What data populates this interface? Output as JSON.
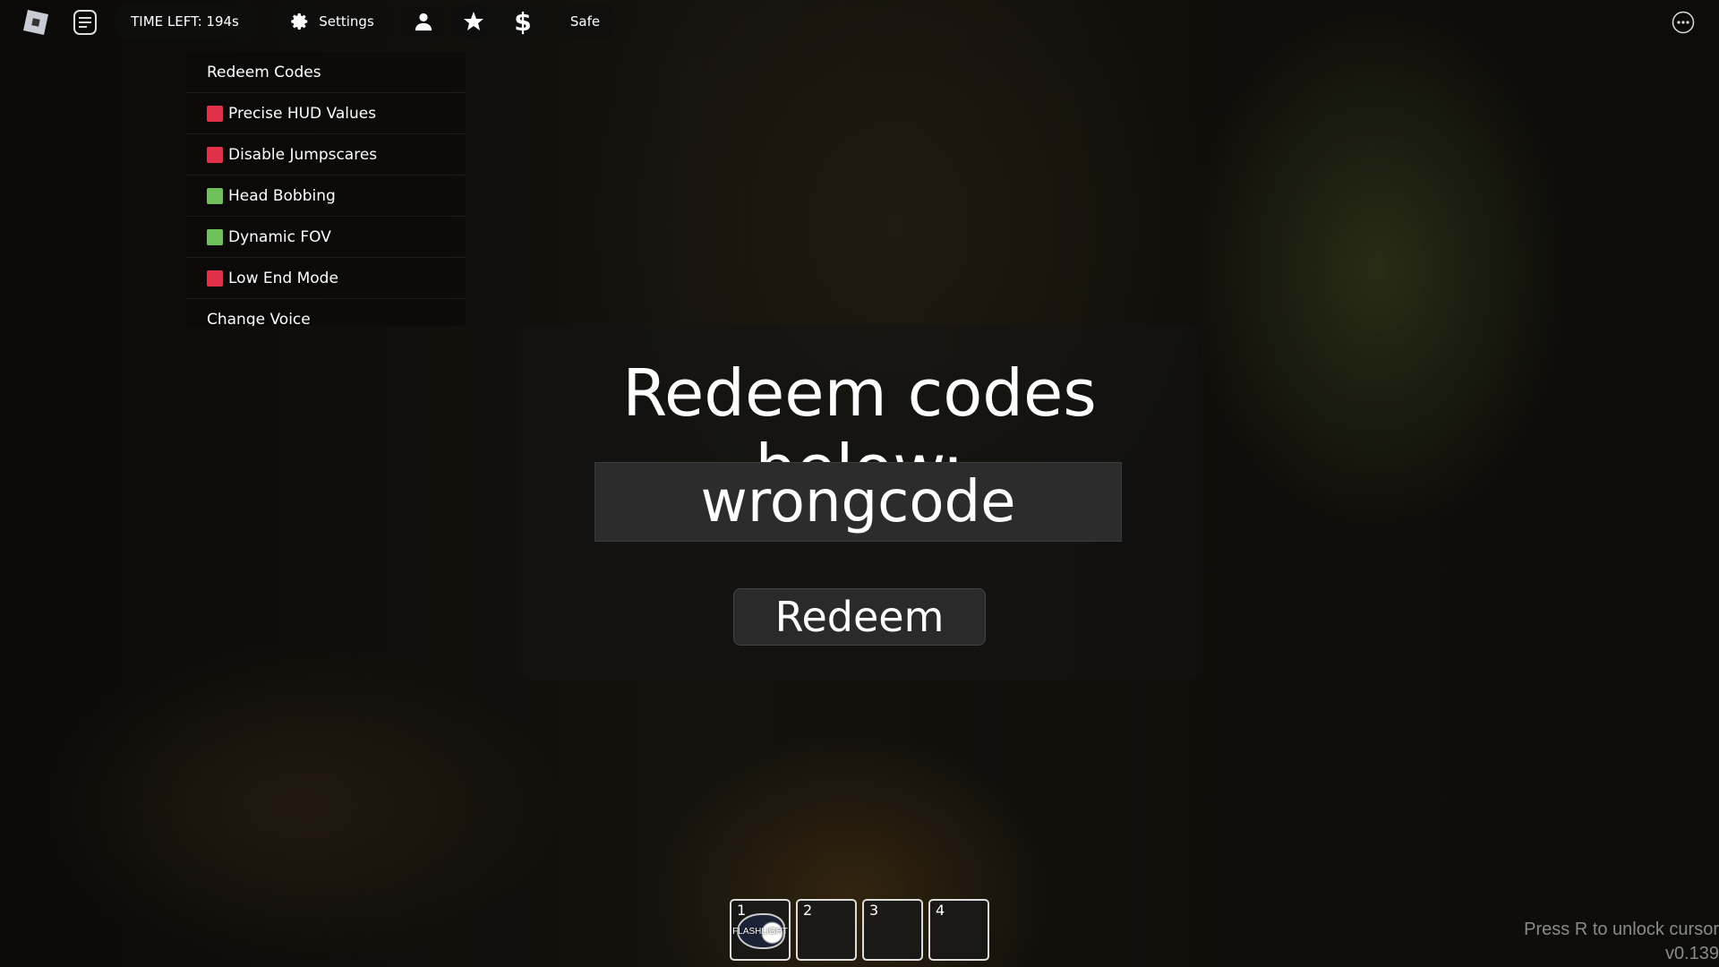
{
  "topbar": {
    "timer": "TIME LEFT: 194s",
    "settings": "Settings",
    "status": "Safe"
  },
  "settings_menu": {
    "items": [
      {
        "label": "Redeem Codes"
      },
      {
        "label": "Precise HUD Values",
        "state": "off",
        "color": "#e0304a"
      },
      {
        "label": "Disable Jumpscares",
        "state": "off",
        "color": "#e0304a"
      },
      {
        "label": "Head Bobbing",
        "state": "on",
        "color": "#6fbf5a"
      },
      {
        "label": "Dynamic FOV",
        "state": "on",
        "color": "#6fbf5a"
      },
      {
        "label": "Low End Mode",
        "state": "off",
        "color": "#e0304a"
      },
      {
        "label": "Change Voice"
      }
    ]
  },
  "redeem": {
    "title": "Redeem codes below:",
    "code_value": "wrongcode",
    "button": "Redeem"
  },
  "hotbar": {
    "slots": [
      {
        "num": "1",
        "item": "FLASHLIGHT"
      },
      {
        "num": "2"
      },
      {
        "num": "3"
      },
      {
        "num": "4"
      }
    ]
  },
  "footer": {
    "hint": "Press R to unlock cursor",
    "version": "v0.139"
  }
}
